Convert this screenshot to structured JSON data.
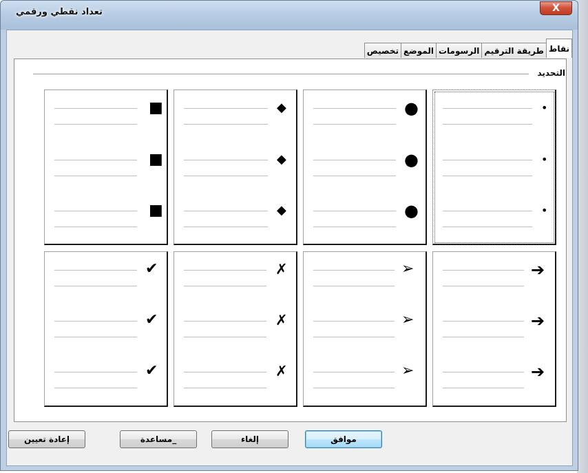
{
  "window": {
    "title": "تعداد نقطي ورقمي",
    "close_label": "X"
  },
  "tabs": [
    {
      "label": "نقاط",
      "active": true
    },
    {
      "label": "طريقة الترقيم",
      "active": false
    },
    {
      "label": "الرسومات",
      "active": false
    },
    {
      "label": "الموضع",
      "active": false
    },
    {
      "label": "تخصيص",
      "active": false
    }
  ],
  "selection_group": {
    "label": "التحديد"
  },
  "bullet_styles": {
    "row1": [
      "small-dot",
      "large-dot",
      "diamond",
      "square"
    ],
    "row2": [
      "bold-arrow",
      "arrowhead",
      "x-mark",
      "checkmark"
    ],
    "selected": "small-dot",
    "glyphs": {
      "small-dot": "•",
      "large-dot": "●",
      "diamond": "◆",
      "square": "■",
      "bold-arrow": "➔",
      "arrowhead": "➢",
      "x-mark": "✗",
      "checkmark": "✔"
    }
  },
  "buttons": {
    "ok": "موافق",
    "cancel": "إلغاء",
    "help": "_مساعدة",
    "reset": "إعادة تعيين"
  },
  "colors": {
    "titlebar": "#b9cde4",
    "close": "#c8452d",
    "default_button": "#bee6fd"
  }
}
